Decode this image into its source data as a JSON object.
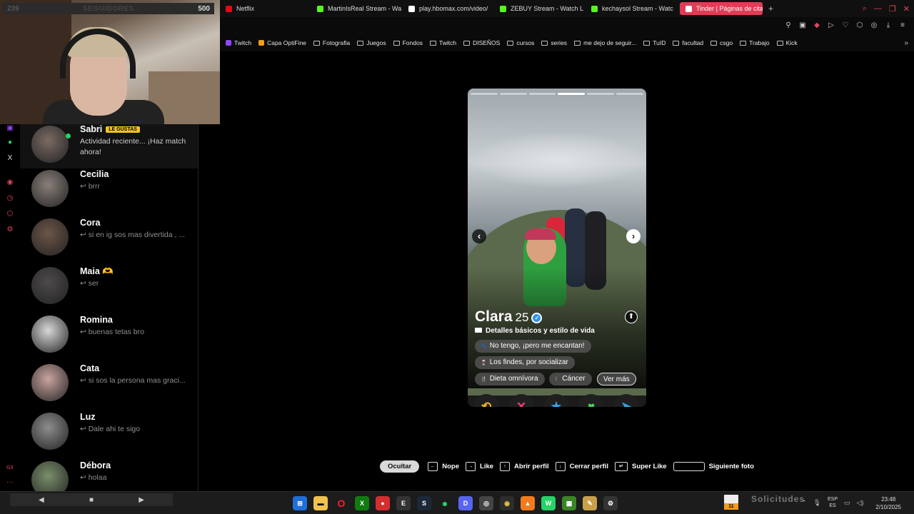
{
  "stream": {
    "follower_left": "239",
    "follower_label": "SEGUIDORES",
    "follower_right": "500"
  },
  "browser": {
    "tabs": [
      {
        "label": "Netflix",
        "color": "#e50914"
      },
      {
        "label": "MartinIsReal Stream - Wa",
        "color": "#53fc18"
      },
      {
        "label": "play.hbomax.com/video/",
        "color": "#ffffff"
      },
      {
        "label": "ZEBUY Stream - Watch L",
        "color": "#53fc18"
      },
      {
        "label": "kechaysol Stream - Watc",
        "color": "#53fc18"
      },
      {
        "label": "Tinder | Páginas de citas",
        "color": "#ffffff",
        "active": true
      }
    ],
    "new_tab": "+",
    "bookmarks": [
      {
        "label": "Twitch",
        "type": "site",
        "color": "#9146ff"
      },
      {
        "label": "Capa OptiFine",
        "type": "site",
        "color": "#f29b1d"
      },
      {
        "label": "Fotografia",
        "type": "folder"
      },
      {
        "label": "Juegos",
        "type": "folder"
      },
      {
        "label": "Fondos",
        "type": "folder"
      },
      {
        "label": "Twitch",
        "type": "folder"
      },
      {
        "label": "DISEÑOS",
        "type": "folder"
      },
      {
        "label": "cursos",
        "type": "folder"
      },
      {
        "label": "series",
        "type": "folder"
      },
      {
        "label": "me dejo de seguir...",
        "type": "folder"
      },
      {
        "label": "TuID",
        "type": "folder"
      },
      {
        "label": "facultad",
        "type": "folder"
      },
      {
        "label": "csgo",
        "type": "folder"
      },
      {
        "label": "Trabajo",
        "type": "folder"
      },
      {
        "label": "Kick",
        "type": "folder"
      }
    ]
  },
  "matches": [
    {
      "name": "Sabri",
      "message": "Actividad reciente... ¡Haz match ahora!",
      "badge": "LE GUSTAS",
      "online": true,
      "avatar": "#7a6b63"
    },
    {
      "name": "Cecilia",
      "message": "↩ brrr",
      "avatar": "#8a7f7a"
    },
    {
      "name": "Cora",
      "message": "↩ si en ig sos mas divertida , ...",
      "avatar": "#6d5548"
    },
    {
      "name": "Maia 🫶",
      "message": "↩ ser",
      "avatar": "#4d4a4c"
    },
    {
      "name": "Romina",
      "message": "↩ buenas tetas bro",
      "avatar": "#d8d8d8"
    },
    {
      "name": "Cata",
      "message": "↩ si sos la persona mas graci...",
      "avatar": "#caa4a0"
    },
    {
      "name": "Luz",
      "message": "↩ Dale ahi te sigo",
      "avatar": "#8d8d8d"
    },
    {
      "name": "Débora",
      "message": "↩ holaa",
      "avatar": "#7a8f6b"
    }
  ],
  "profile": {
    "name": "Clara",
    "age": "25",
    "details_heading": "Detalles básicos y estilo de vida",
    "chips": [
      "No tengo, ¡pero me encantan!",
      "Los findes, por socializar",
      "Dieta omnívora",
      "Cáncer"
    ],
    "more": "Ver más",
    "photo_count": 6,
    "current_photo": 4
  },
  "actions": {
    "rewind": "⟲",
    "nope": "✕",
    "superlike": "★",
    "like": "♥",
    "boost": "➤"
  },
  "hotkeys": {
    "hide": "Ocultar",
    "nope": "Nope",
    "like": "Like",
    "open_profile": "Abrir perfil",
    "close_profile": "Cerrar perfil",
    "super_like": "Super Like",
    "next_photo": "Siguiente foto"
  },
  "taskbar": {
    "mail_count": "11",
    "solicitudes": "Solicitudes",
    "lang_top": "ESP",
    "lang_bottom": "ES",
    "time": "23:48",
    "date": "2/10/2025"
  }
}
